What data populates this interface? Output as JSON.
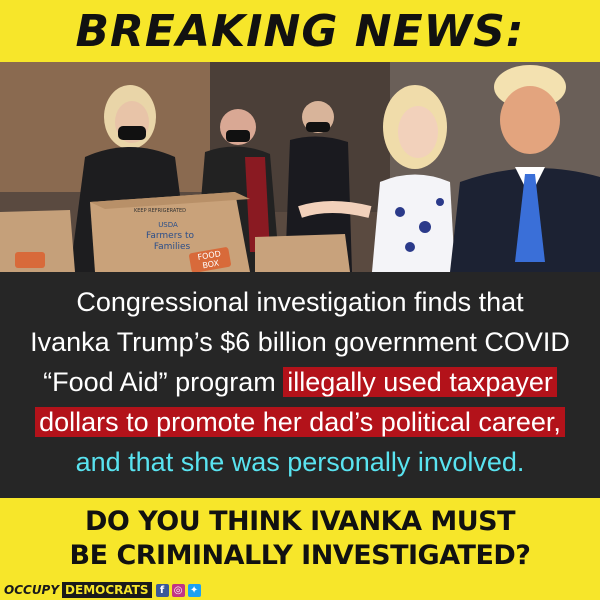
{
  "header": {
    "title": "BREAKING NEWS:"
  },
  "photo": {
    "box_labels": [
      "KEEP REFRIGERATED",
      "USDA",
      "Farmers to",
      "Families",
      "FOOD",
      "BOX"
    ]
  },
  "caption": {
    "line1": "Congressional investigation finds that",
    "line2": "Ivanka Trump’s $6 billion government COVID",
    "line3_plain": "“Food Aid” program",
    "line3_highlight": "illegally used taxpayer",
    "line4_highlight": "dollars to promote her dad’s political career,",
    "line5": "and that she was personally involved."
  },
  "question": {
    "line1": "DO YOU THINK IVANKA MUST",
    "line2": "BE CRIMINALLY INVESTIGATED?"
  },
  "footer": {
    "brand_part1": "OCCUPY",
    "brand_part2": "DEMOCRATS",
    "icons": [
      "facebook-icon",
      "instagram-icon",
      "twitter-icon"
    ]
  },
  "colors": {
    "banner_yellow": "#f7e62a",
    "caption_bg": "#262626",
    "highlight_red": "#b3121a",
    "highlight_cyan": "#59e3f0"
  }
}
